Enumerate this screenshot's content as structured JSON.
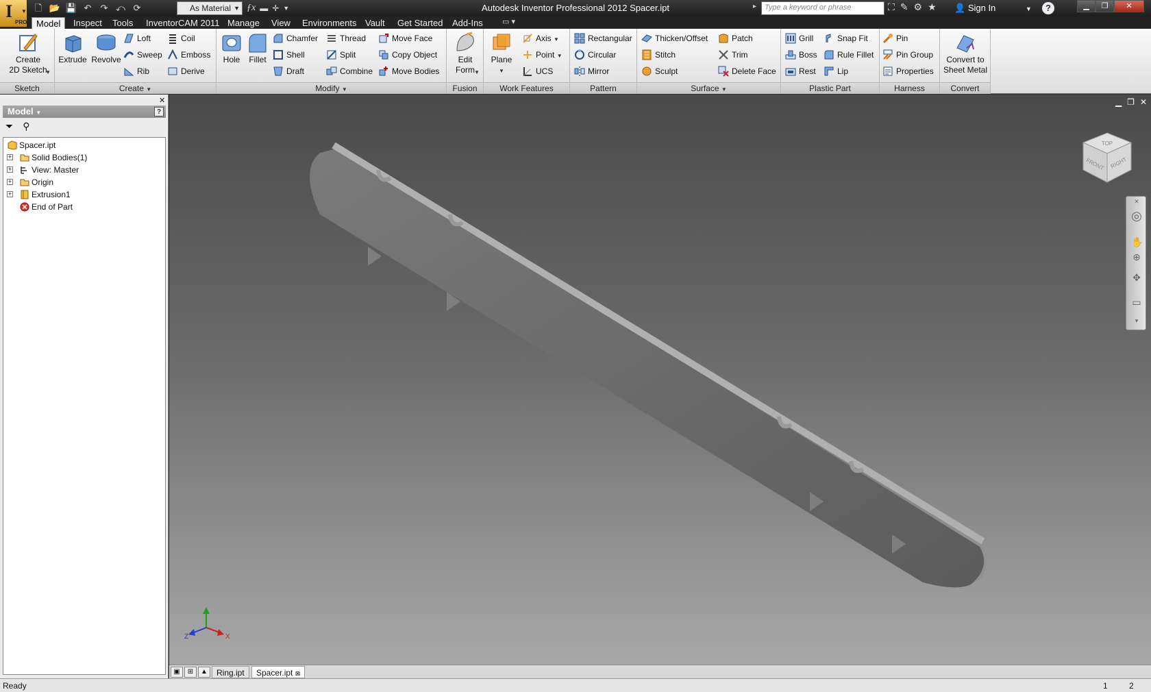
{
  "window": {
    "title": "Autodesk Inventor Professional 2012    Spacer.ipt",
    "material": "As Material",
    "search_placeholder": "Type a keyword or phrase",
    "sign_in": "Sign In"
  },
  "app_button": {
    "glyph": "I",
    "badge": "PRO"
  },
  "tabs": [
    "Model",
    "Inspect",
    "Tools",
    "InventorCAM 2011",
    "Manage",
    "View",
    "Environments",
    "Vault",
    "Get Started",
    "Add-Ins"
  ],
  "ribbon": {
    "sketch": {
      "title": "Sketch",
      "create_2d_sketch": "Create\n2D Sketch"
    },
    "create": {
      "title": "Create",
      "extrude": "Extrude",
      "revolve": "Revolve",
      "loft": "Loft",
      "sweep": "Sweep",
      "rib": "Rib",
      "coil": "Coil",
      "emboss": "Emboss",
      "derive": "Derive"
    },
    "modify": {
      "title": "Modify",
      "hole": "Hole",
      "fillet": "Fillet",
      "chamfer": "Chamfer",
      "shell": "Shell",
      "draft": "Draft",
      "thread": "Thread",
      "split": "Split",
      "combine": "Combine",
      "move_face": "Move Face",
      "copy_object": "Copy Object",
      "move_bodies": "Move Bodies"
    },
    "fusion": {
      "title": "Fusion",
      "edit_form": "Edit\nForm"
    },
    "work_features": {
      "title": "Work Features",
      "plane": "Plane",
      "axis": "Axis",
      "point": "Point",
      "ucs": "UCS"
    },
    "pattern": {
      "title": "Pattern",
      "rectangular": "Rectangular",
      "circular": "Circular",
      "mirror": "Mirror"
    },
    "surface": {
      "title": "Surface",
      "thicken_offset": "Thicken/Offset",
      "stitch": "Stitch",
      "sculpt": "Sculpt",
      "patch": "Patch",
      "trim": "Trim",
      "delete_face": "Delete Face"
    },
    "plastic_part": {
      "title": "Plastic Part",
      "grill": "Grill",
      "boss": "Boss",
      "rest": "Rest",
      "snap_fit": "Snap Fit",
      "rule_fillet": "Rule Fillet",
      "lip": "Lip"
    },
    "harness": {
      "title": "Harness",
      "pin": "Pin",
      "pin_group": "Pin Group",
      "properties": "Properties"
    },
    "convert": {
      "title": "Convert",
      "convert_to_sheet_metal": "Convert to\nSheet Metal"
    }
  },
  "browser": {
    "title": "Model",
    "help": "?",
    "tree": [
      {
        "label": "Spacer.ipt"
      },
      {
        "label": "Solid Bodies(1)"
      },
      {
        "label": "View: Master"
      },
      {
        "label": "Origin"
      },
      {
        "label": "Extrusion1"
      },
      {
        "label": "End of Part"
      }
    ]
  },
  "viewcube": {
    "top": "TOP",
    "front": "FRONT",
    "right": "RIGHT"
  },
  "triad": {
    "x": "X",
    "y": "Y",
    "z": "Z"
  },
  "document_tabs": [
    "Ring.ipt",
    "Spacer.ipt"
  ],
  "status": {
    "text": "Ready",
    "n1": "1",
    "n2": "2"
  },
  "colors": {
    "accent": "#f0a030",
    "titlebar": "#262626",
    "ribbon": "#e8e8e8",
    "model": "#6e6e6e"
  }
}
